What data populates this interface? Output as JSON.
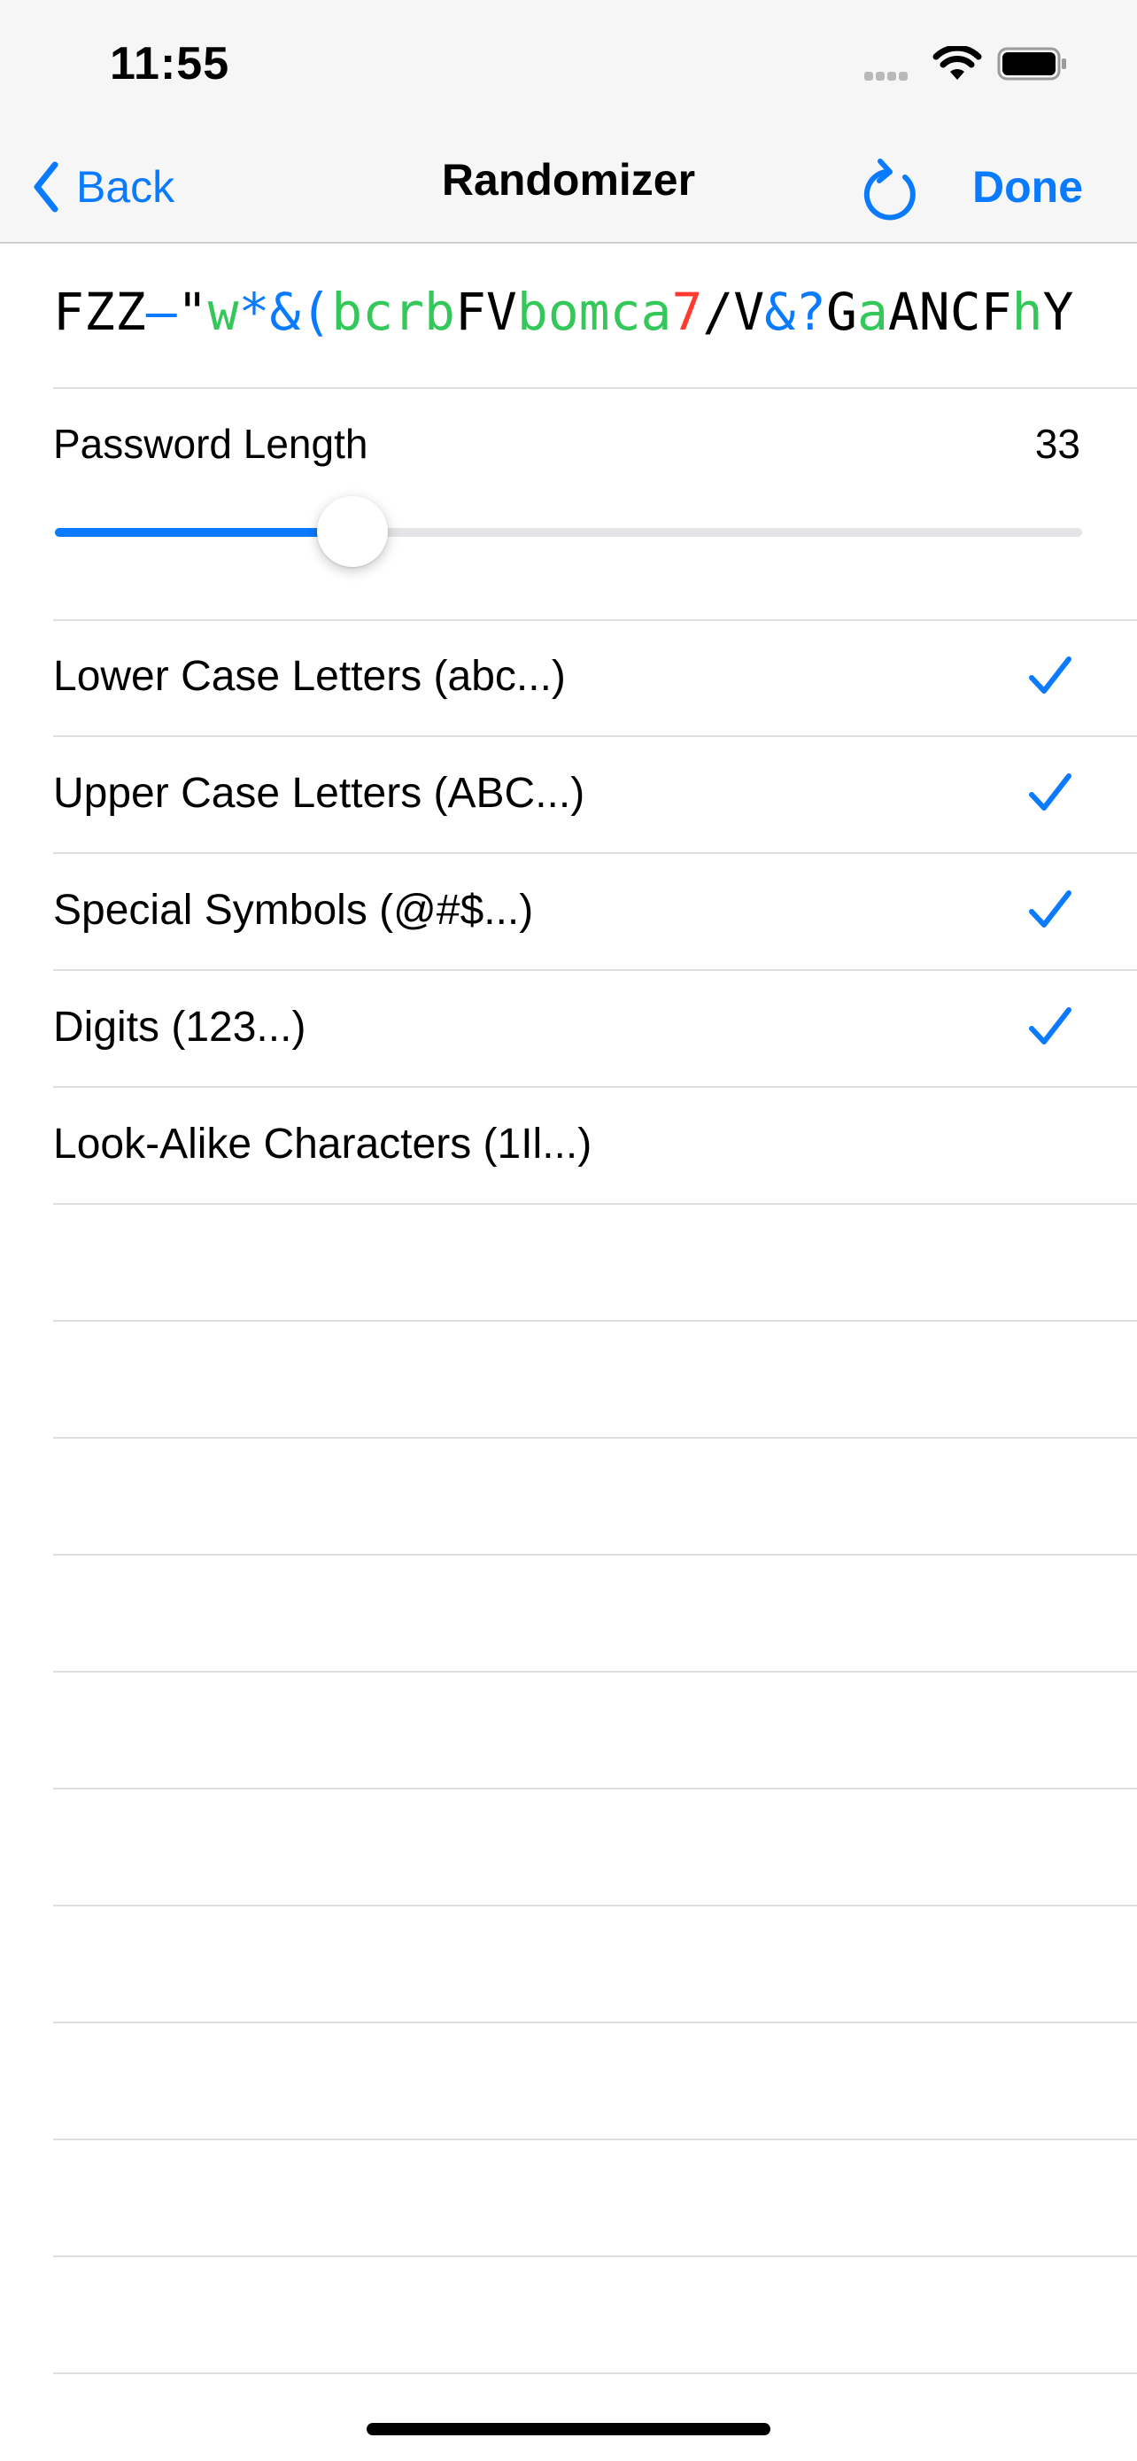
{
  "status_bar": {
    "time": "11:55"
  },
  "nav": {
    "back_label": "Back",
    "title": "Randomizer",
    "done_label": "Done"
  },
  "password": {
    "segments": [
      {
        "text": "FZZ",
        "color": "#000000"
      },
      {
        "text": "–",
        "color": "#0a7aff"
      },
      {
        "text": "\"",
        "color": "#000000"
      },
      {
        "text": "w",
        "color": "#34c759"
      },
      {
        "text": "*&(",
        "color": "#0a7aff"
      },
      {
        "text": "bcrb",
        "color": "#34c759"
      },
      {
        "text": "FV",
        "color": "#000000"
      },
      {
        "text": "bomca",
        "color": "#34c759"
      },
      {
        "text": "7",
        "color": "#ff3b30"
      },
      {
        "text": "/V",
        "color": "#000000"
      },
      {
        "text": "&?",
        "color": "#0a7aff"
      },
      {
        "text": "G",
        "color": "#000000"
      },
      {
        "text": "a",
        "color": "#34c759"
      },
      {
        "text": "ANCF",
        "color": "#000000"
      },
      {
        "text": "h",
        "color": "#34c759"
      },
      {
        "text": "Y",
        "color": "#000000"
      }
    ]
  },
  "length": {
    "label": "Password Length",
    "value": "33",
    "slider_fraction": 0.29
  },
  "options": [
    {
      "label": "Lower Case Letters (abc...)",
      "checked": true
    },
    {
      "label": "Upper Case Letters (ABC...)",
      "checked": true
    },
    {
      "label": "Special Symbols (@#$...)",
      "checked": true
    },
    {
      "label": "Digits (123...)",
      "checked": true
    },
    {
      "label": "Look-Alike Characters (1Il...)",
      "checked": false
    }
  ],
  "colors": {
    "accent": "#0a7aff",
    "lower": "#34c759",
    "digit": "#ff3b30",
    "symbol": "#0a7aff"
  }
}
